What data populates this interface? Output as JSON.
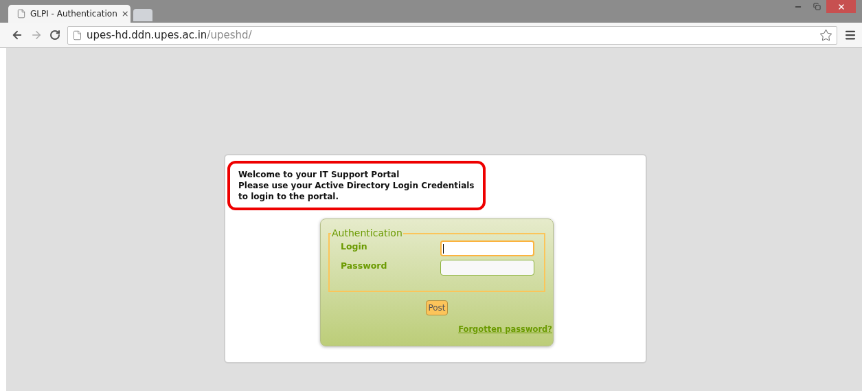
{
  "browser": {
    "tabs": [
      {
        "title": "GLPI - Authentication",
        "close": "×",
        "selected": true
      },
      {
        "selected": false
      }
    ],
    "address": {
      "host": "upes-hd.ddn.upes.ac.in",
      "path": "/upeshd/"
    }
  },
  "notice": {
    "lines": [
      "Welcome to your IT Support Portal",
      "Please use your Active Directory Login Credentials",
      "to login to the portal."
    ]
  },
  "login_form": {
    "legend": "Authentication",
    "fields": [
      {
        "label": "Login",
        "focused": true
      },
      {
        "label": "Password",
        "focused": false
      }
    ],
    "submit": "Post",
    "forgot_link": "Forgotten password?"
  }
}
